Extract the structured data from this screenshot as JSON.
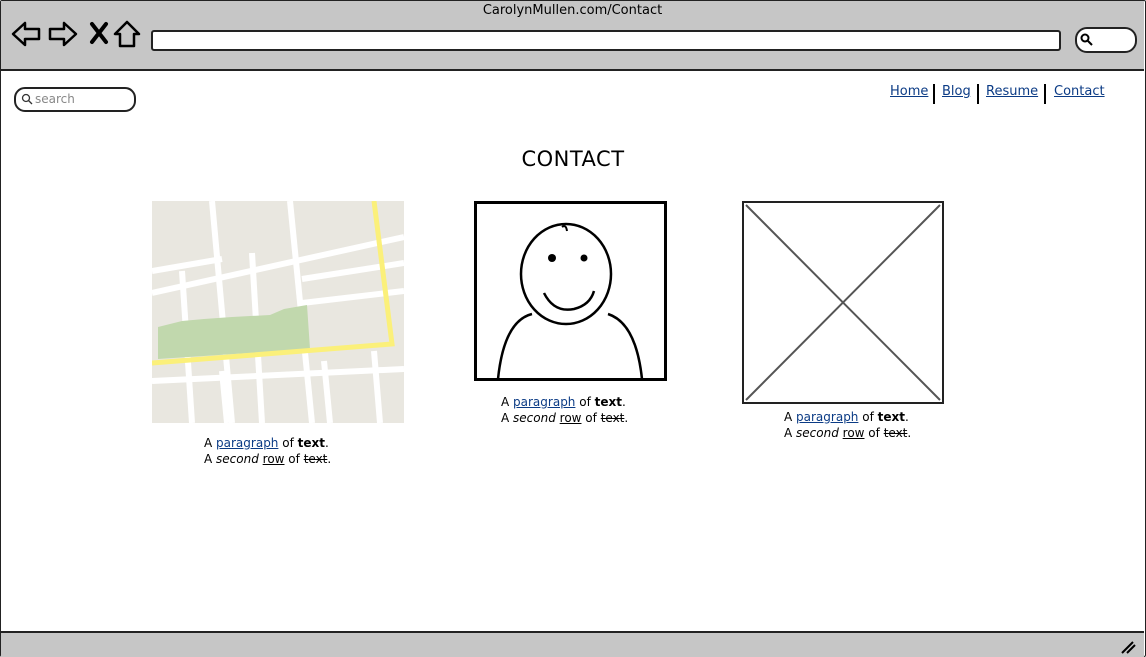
{
  "browser": {
    "title": "CarolynMullen.com/Contact",
    "address_value": "",
    "icons": [
      "back-arrow-icon",
      "forward-arrow-icon",
      "close-icon",
      "home-icon",
      "search-icon"
    ]
  },
  "search": {
    "placeholder": "search"
  },
  "nav": {
    "items": [
      {
        "label": "Home"
      },
      {
        "label": "Blog"
      },
      {
        "label": "Resume"
      },
      {
        "label": "Contact"
      }
    ]
  },
  "page": {
    "heading": "CONTACT"
  },
  "cards": [
    {
      "image": "map-image",
      "p1_pre": "A ",
      "p1_link": "paragraph",
      "p1_mid": " of ",
      "p1_bold": "text",
      "p1_end": ".",
      "p2_pre": "A ",
      "p2_italic": "second",
      "p2_sp": " ",
      "p2_under": "row",
      "p2_mid": " of ",
      "p2_strike": "text",
      "p2_end": "."
    },
    {
      "image": "user-avatar-image",
      "p1_pre": "A ",
      "p1_link": "paragraph",
      "p1_mid": " of ",
      "p1_bold": "text",
      "p1_end": ".",
      "p2_pre": "A ",
      "p2_italic": "second",
      "p2_sp": " ",
      "p2_under": "row",
      "p2_mid": " of ",
      "p2_strike": "text",
      "p2_end": "."
    },
    {
      "image": "image-placeholder",
      "p1_pre": "A ",
      "p1_link": "paragraph",
      "p1_mid": " of ",
      "p1_bold": "text",
      "p1_end": ".",
      "p2_pre": "A ",
      "p2_italic": "second",
      "p2_sp": " ",
      "p2_under": "row",
      "p2_mid": " of ",
      "p2_strike": "text",
      "p2_end": "."
    }
  ],
  "colors": {
    "chrome": "#c6c6c6",
    "link": "#0b3b85",
    "map_road": "#ffffff",
    "map_bg": "#e9e7e0",
    "map_park": "#c1d8ad",
    "map_highway": "#fbf07a"
  }
}
